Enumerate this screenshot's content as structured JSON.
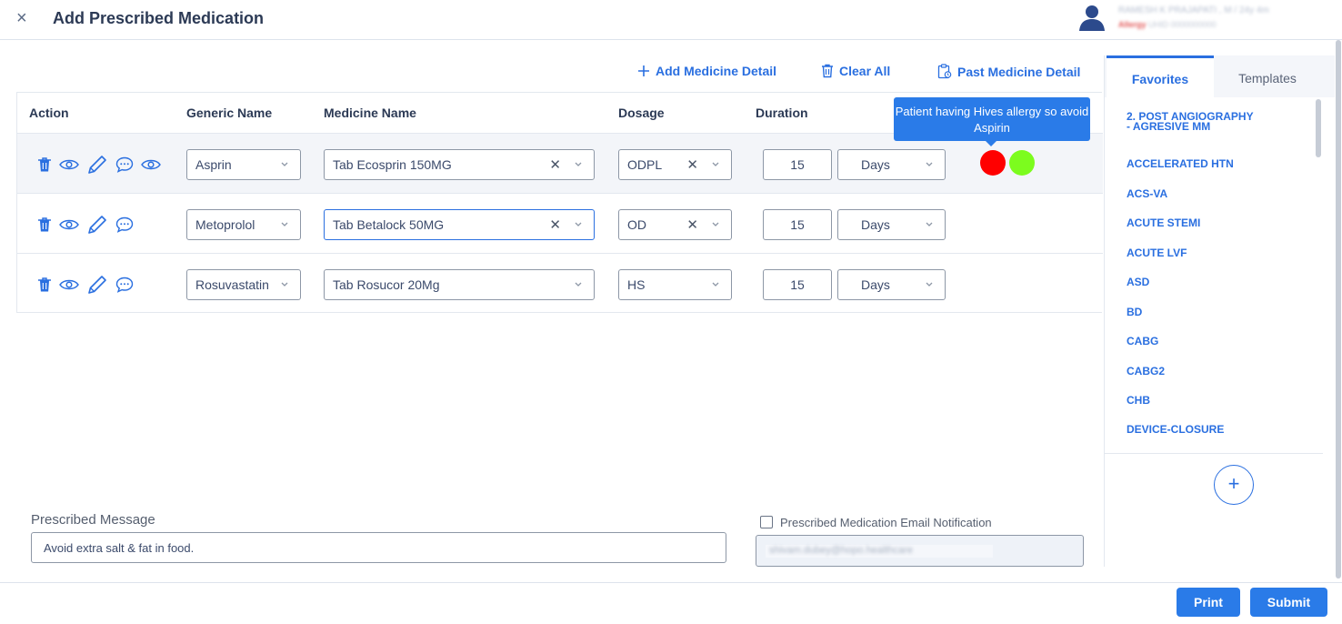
{
  "header": {
    "title": "Add Prescribed Medication",
    "close_icon": "×",
    "user_name": "RAMESH K PRAJAPATI , M / 24y 4m",
    "user_flag": "Allergy",
    "user_meta": "UHID 0000000000"
  },
  "toolbar": {
    "add_label": "Add Medicine Detail",
    "clear_label": "Clear All",
    "past_label": "Past Medicine Detail"
  },
  "table": {
    "headers": {
      "action": "Action",
      "generic": "Generic Name",
      "medicine": "Medicine Name",
      "dosage": "Dosage",
      "duration": "Duration"
    },
    "rows": [
      {
        "generic": "Asprin",
        "medicine": "Tab Ecosprin 150MG",
        "dosage": "ODPL",
        "duration": "15",
        "unit": "Days"
      },
      {
        "generic": "Metoprolol",
        "medicine": "Tab Betalock 50MG",
        "dosage": "OD",
        "duration": "15",
        "unit": "Days"
      },
      {
        "generic": "Rosuvastatin",
        "medicine": "Tab Rosucor 20Mg",
        "dosage": "HS",
        "duration": "15",
        "unit": "Days"
      }
    ],
    "tooltip": "Patient having Hives allergy so avoid Aspirin",
    "status_colors": {
      "alert": "#ff0000",
      "ok": "#7cfc1e"
    }
  },
  "message": {
    "label": "Prescribed Message",
    "value": "Avoid extra salt & fat in food."
  },
  "email": {
    "label": "Prescribed Medication Email Notification",
    "value": "shivam.dubey@hopo.healthcare"
  },
  "footer": {
    "print_label": "Print",
    "submit_label": "Submit"
  },
  "panel": {
    "tab_favorites": "Favorites",
    "tab_templates": "Templates",
    "favorites": [
      "2. POST ANGIOGRAPHY - AGRESIVE MM",
      "ACCELERATED HTN",
      "ACS-VA",
      "ACUTE STEMI",
      "ACUTE LVF",
      "ASD",
      "BD",
      "CABG",
      "CABG2",
      "CHB",
      "DEVICE-CLOSURE"
    ],
    "add_icon": "+"
  },
  "accent": "#2a6fe0"
}
